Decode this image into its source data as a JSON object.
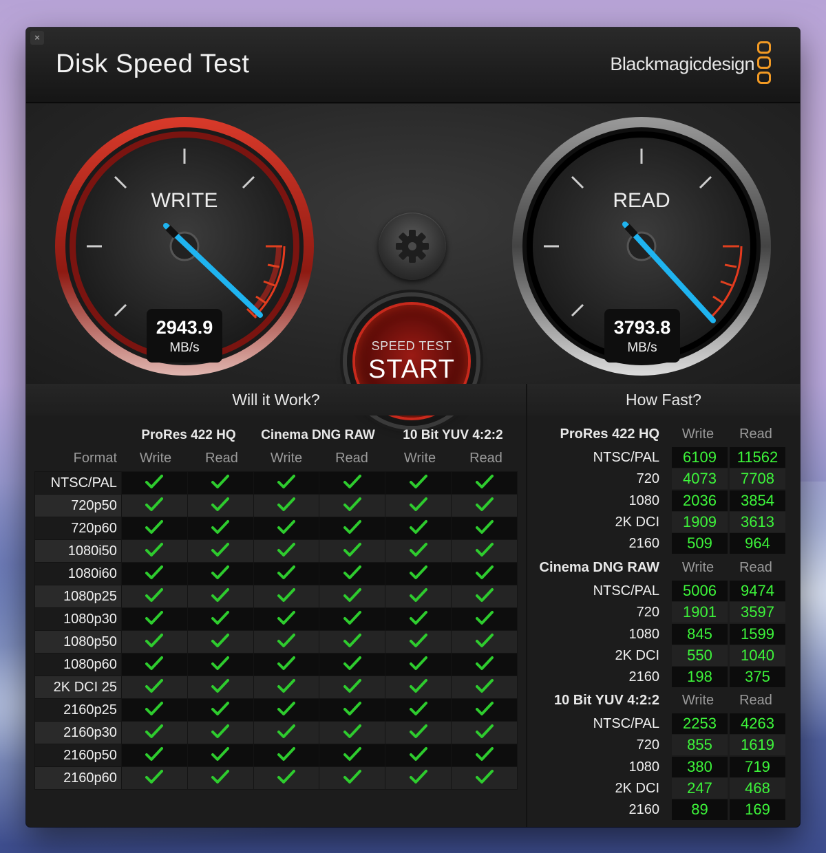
{
  "window": {
    "close_glyph": "×",
    "title": "Disk Speed Test",
    "brand": "Blackmagicdesign"
  },
  "gauges": {
    "write": {
      "label": "WRITE",
      "value": "2943.9",
      "unit": "MB/s"
    },
    "read": {
      "label": "READ",
      "value": "3793.8",
      "unit": "MB/s"
    }
  },
  "start_button": {
    "small": "SPEED TEST",
    "big": "START"
  },
  "will_it_work": {
    "title": "Will it Work?",
    "format_label": "Format",
    "codecs": [
      "ProRes 422 HQ",
      "Cinema DNG RAW",
      "10 Bit YUV 4:2:2"
    ],
    "sub": [
      "Write",
      "Read",
      "Write",
      "Read",
      "Write",
      "Read"
    ],
    "rows": [
      "NTSC/PAL",
      "720p50",
      "720p60",
      "1080i50",
      "1080i60",
      "1080p25",
      "1080p30",
      "1080p50",
      "1080p60",
      "2K DCI 25",
      "2160p25",
      "2160p30",
      "2160p50",
      "2160p60"
    ],
    "check_color": "#2ecc2e"
  },
  "how_fast": {
    "title": "How Fast?",
    "write_label": "Write",
    "read_label": "Read",
    "groups": [
      {
        "name": "ProRes 422 HQ",
        "rows": [
          {
            "label": "NTSC/PAL",
            "write": "6109",
            "read": "11562"
          },
          {
            "label": "720",
            "write": "4073",
            "read": "7708"
          },
          {
            "label": "1080",
            "write": "2036",
            "read": "3854"
          },
          {
            "label": "2K DCI",
            "write": "1909",
            "read": "3613"
          },
          {
            "label": "2160",
            "write": "509",
            "read": "964"
          }
        ]
      },
      {
        "name": "Cinema DNG RAW",
        "rows": [
          {
            "label": "NTSC/PAL",
            "write": "5006",
            "read": "9474"
          },
          {
            "label": "720",
            "write": "1901",
            "read": "3597"
          },
          {
            "label": "1080",
            "write": "845",
            "read": "1599"
          },
          {
            "label": "2K DCI",
            "write": "550",
            "read": "1040"
          },
          {
            "label": "2160",
            "write": "198",
            "read": "375"
          }
        ]
      },
      {
        "name": "10 Bit YUV 4:2:2",
        "rows": [
          {
            "label": "NTSC/PAL",
            "write": "2253",
            "read": "4263"
          },
          {
            "label": "720",
            "write": "855",
            "read": "1619"
          },
          {
            "label": "1080",
            "write": "380",
            "read": "719"
          },
          {
            "label": "2K DCI",
            "write": "247",
            "read": "468"
          },
          {
            "label": "2160",
            "write": "89",
            "read": "169"
          }
        ]
      }
    ]
  },
  "colors": {
    "accent_orange": "#f29a24",
    "value_green": "#3df53a",
    "needle_blue": "#1fb4f0",
    "write_ring": "#b5231a"
  }
}
